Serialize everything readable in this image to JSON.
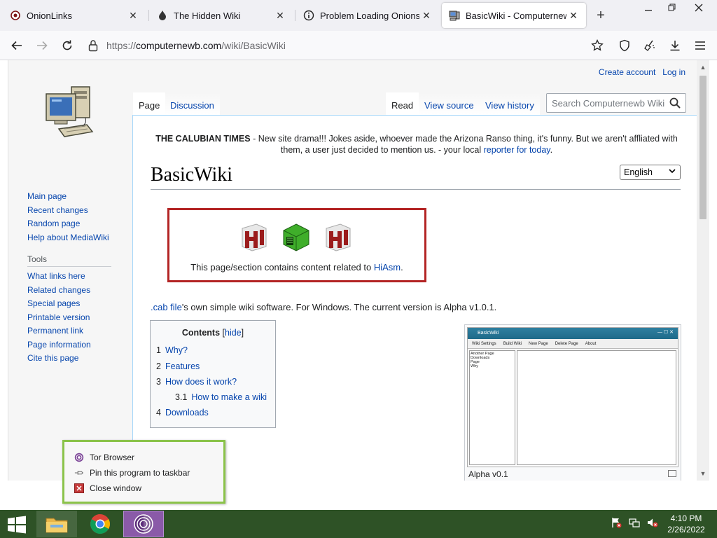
{
  "browser": {
    "tabs": [
      {
        "title": "OnionLinks",
        "active": false
      },
      {
        "title": "The Hidden Wiki",
        "active": false
      },
      {
        "title": "Problem Loading Onionsite",
        "active": false
      },
      {
        "title": "BasicWiki - Computernewb \\",
        "active": true
      }
    ],
    "url_prefix": "https://",
    "url_domain": "computernewb.com",
    "url_path": "/wiki/BasicWiki"
  },
  "wiki": {
    "personal": {
      "create_account": "Create account",
      "log_in": "Log in"
    },
    "tabs": {
      "page": "Page",
      "discussion": "Discussion",
      "read": "Read",
      "view_source": "View source",
      "view_history": "View history"
    },
    "search_placeholder": "Search Computernewb Wiki",
    "sidebar": {
      "nav": [
        "Main page",
        "Recent changes",
        "Random page",
        "Help about MediaWiki"
      ],
      "tools_heading": "Tools",
      "tools": [
        "What links here",
        "Related changes",
        "Special pages",
        "Printable version",
        "Permanent link",
        "Page information",
        "Cite this page"
      ]
    },
    "sitenotice": {
      "bold": "THE CALUBIAN TIMES",
      "text1": " - New site drama!!! Jokes aside, whoever made the Arizona Ranso thing, it's funny. But we aren't affliated with them, a user just decided to mention us. - your local ",
      "link": "reporter for today",
      "text2": "."
    },
    "title": "BasicWiki",
    "language": "English",
    "notice_box": {
      "text": "This page/section contains content related to ",
      "link": "HiAsm",
      "end": "."
    },
    "intro": {
      "link": ".cab file",
      "text": "'s own simple wiki software. For Windows. The current version is Alpha v1.0.1."
    },
    "toc": {
      "title": "Contents",
      "hide": "hide",
      "items": [
        {
          "num": "1",
          "label": "Why?"
        },
        {
          "num": "2",
          "label": "Features"
        },
        {
          "num": "3",
          "label": "How does it work?"
        },
        {
          "num": "3.1",
          "label": "How to make a wiki"
        },
        {
          "num": "4",
          "label": "Downloads"
        }
      ]
    },
    "thumb": {
      "caption": "Alpha v0.1",
      "window_title": "BasicWiki",
      "toolbar": [
        "Wiki Settings",
        "Build Wiki",
        "New Page",
        "Delete Page",
        "About"
      ],
      "pages": [
        "Another Page",
        "Downloads",
        "Page",
        "Why"
      ]
    },
    "section_fragment": "s:"
  },
  "jumplist": {
    "items": [
      "Tor Browser",
      "Pin this program to taskbar",
      "Close window"
    ]
  },
  "taskbar": {
    "time": "4:10 PM",
    "date": "2/26/2022"
  },
  "colors": {
    "taskbar": "#2e5226",
    "jumplist_border": "#8bc34a",
    "notice_border": "#b32424",
    "link": "#0645ad"
  }
}
